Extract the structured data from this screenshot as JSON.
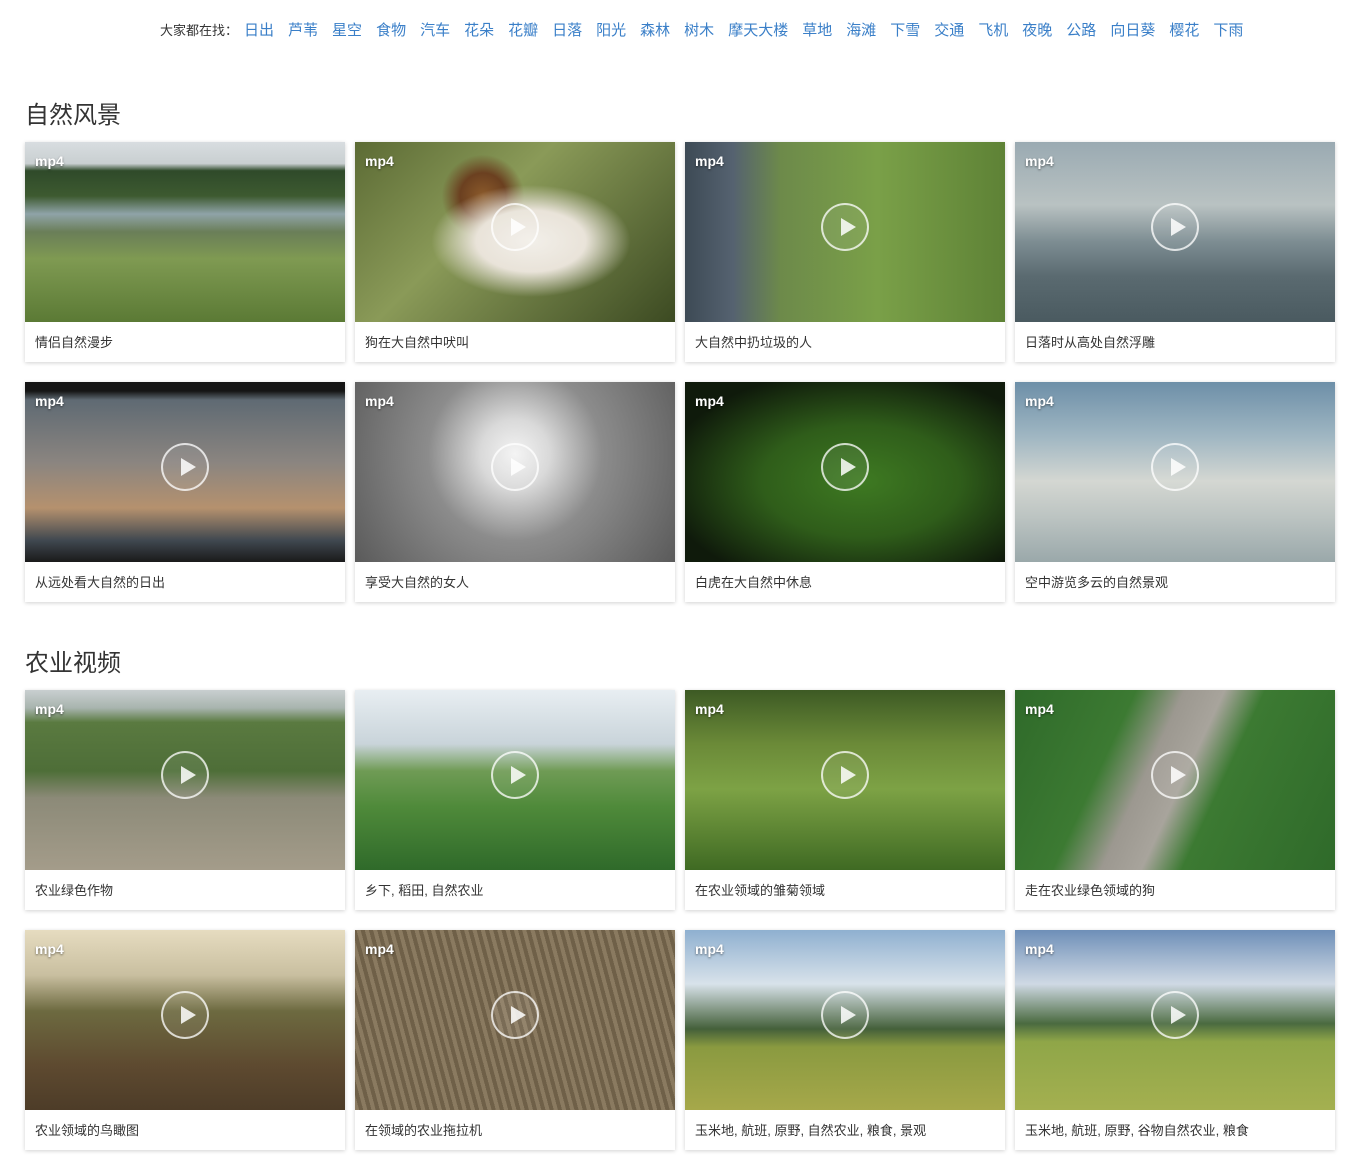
{
  "search_bar": {
    "label": "大家都在找：",
    "tags": [
      "日出",
      "芦苇",
      "星空",
      "食物",
      "汽车",
      "花朵",
      "花瓣",
      "日落",
      "阳光",
      "森林",
      "树木",
      "摩天大楼",
      "草地",
      "海滩",
      "下雪",
      "交通",
      "飞机",
      "夜晚",
      "公路",
      "向日葵",
      "樱花",
      "下雨"
    ]
  },
  "sections": [
    {
      "title": "自然风景",
      "items": [
        {
          "badge": "mp4",
          "caption": "情侣自然漫步",
          "play": false
        },
        {
          "badge": "mp4",
          "caption": "狗在大自然中吠叫",
          "play": true
        },
        {
          "badge": "mp4",
          "caption": "大自然中扔垃圾的人",
          "play": true
        },
        {
          "badge": "mp4",
          "caption": "日落时从高处自然浮雕",
          "play": true
        },
        {
          "badge": "mp4",
          "caption": "从远处看大自然的日出",
          "play": true
        },
        {
          "badge": "mp4",
          "caption": "享受大自然的女人",
          "play": true
        },
        {
          "badge": "mp4",
          "caption": "白虎在大自然中休息",
          "play": true
        },
        {
          "badge": "mp4",
          "caption": "空中游览多云的自然景观",
          "play": true
        }
      ]
    },
    {
      "title": "农业视频",
      "items": [
        {
          "badge": "mp4",
          "caption": "农业绿色作物",
          "play": true
        },
        {
          "badge": "",
          "caption": "乡下, 稻田, 自然农业",
          "play": true
        },
        {
          "badge": "mp4",
          "caption": "在农业领域的雏菊领域",
          "play": true
        },
        {
          "badge": "mp4",
          "caption": "走在农业绿色领域的狗",
          "play": true
        },
        {
          "badge": "mp4",
          "caption": "农业领域的鸟瞰图",
          "play": true
        },
        {
          "badge": "mp4",
          "caption": "在领域的农业拖拉机",
          "play": true
        },
        {
          "badge": "mp4",
          "caption": "玉米地, 航班, 原野, 自然农业, 粮食, 景观",
          "play": true
        },
        {
          "badge": "mp4",
          "caption": "玉米地, 航班, 原野, 谷物自然农业, 粮食",
          "play": true
        }
      ]
    }
  ]
}
